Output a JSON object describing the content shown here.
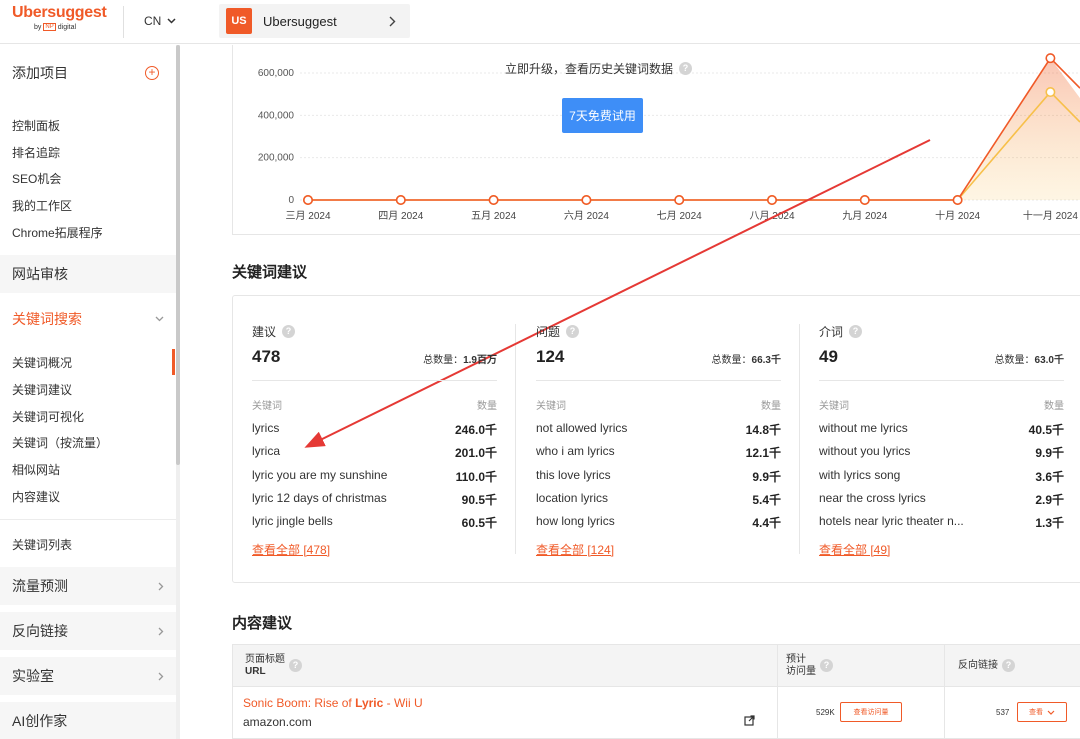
{
  "topbar": {
    "logo_main": "Ubersuggest",
    "logo_by": "by",
    "logo_np": "NP",
    "logo_digital": "digital",
    "lang": "CN",
    "project_badge": "US",
    "project_name": "Ubersuggest"
  },
  "sidebar": {
    "add_project": "添加项目",
    "items_top": [
      "控制面板",
      "排名追踪",
      "SEO机会",
      "我的工作区",
      "Chrome拓展程序"
    ],
    "site_audit": "网站审核",
    "keyword_research": "关键词搜索",
    "kw_items": [
      "关键词概况",
      "关键词建议",
      "关键词可视化",
      "关键词（按流量）",
      "相似网站",
      "内容建议"
    ],
    "kw_list": "关键词列表",
    "traffic": "流量预测",
    "backlinks": "反向链接",
    "lab": "实验室",
    "ai_writer": "AI创作家"
  },
  "chart": {
    "upgrade_text": "立即升级，查看历史关键词数据",
    "trial_button": "7天免费试用",
    "accent": "#f05a28",
    "chart_data": {
      "type": "line",
      "categories": [
        "三月 2024",
        "四月 2024",
        "五月 2024",
        "六月 2024",
        "七月 2024",
        "八月 2024",
        "九月 2024",
        "十月 2024",
        "十一月 2024"
      ],
      "yticks": [
        "0",
        "200,000",
        "400,000",
        "600,000"
      ],
      "ylim": [
        0,
        700000
      ],
      "series": [
        {
          "values": [
            0,
            0,
            0,
            0,
            0,
            0,
            0,
            0,
            670000
          ],
          "color": "#f05a28"
        },
        {
          "values": [
            0,
            0,
            0,
            0,
            0,
            0,
            0,
            0,
            510000
          ],
          "color": "#f7c04a"
        }
      ]
    }
  },
  "keyword_suggestions": {
    "title": "关键词建议",
    "col_keyword": "关键词",
    "col_volume": "数量",
    "total_label": "总数量：",
    "columns": [
      {
        "head": "建议",
        "count": "478",
        "total": "1.9百万",
        "rows": [
          [
            "lyrics",
            "246.0千"
          ],
          [
            "lyrica",
            "201.0千"
          ],
          [
            "lyric you are my sunshine",
            "110.0千"
          ],
          [
            "lyric 12 days of christmas",
            "90.5千"
          ],
          [
            "lyric jingle bells",
            "60.5千"
          ]
        ],
        "link": "查看全部 [478]"
      },
      {
        "head": "问题",
        "count": "124",
        "total": "66.3千",
        "rows": [
          [
            "not allowed lyrics",
            "14.8千"
          ],
          [
            "who i am lyrics",
            "12.1千"
          ],
          [
            "this love lyrics",
            "9.9千"
          ],
          [
            "location lyrics",
            "5.4千"
          ],
          [
            "how long lyrics",
            "4.4千"
          ]
        ],
        "link": "查看全部 [124]"
      },
      {
        "head": "介词",
        "count": "49",
        "total": "63.0千",
        "rows": [
          [
            "without me lyrics",
            "40.5千"
          ],
          [
            "without you lyrics",
            "9.9千"
          ],
          [
            "with lyrics song",
            "3.6千"
          ],
          [
            "near the cross lyrics",
            "2.9千"
          ],
          [
            "hotels near lyric theater n...",
            "1.3千"
          ]
        ],
        "link": "查看全部 [49]"
      }
    ]
  },
  "content_suggestions": {
    "title": "内容建议",
    "h_page_title": "页面标题",
    "h_url": "URL",
    "h_est_1": "预计",
    "h_est_2": "访问量",
    "h_backlinks": "反向链接",
    "row_title_pre": "Sonic Boom: Rise of ",
    "row_title_bold": "Lyric",
    "row_title_post": " - Wii U",
    "row_url": "amazon.com",
    "row_visits": "529K",
    "row_visits_btn": "查看访问量",
    "row_backlinks": "537",
    "row_backlinks_btn": "查看"
  }
}
